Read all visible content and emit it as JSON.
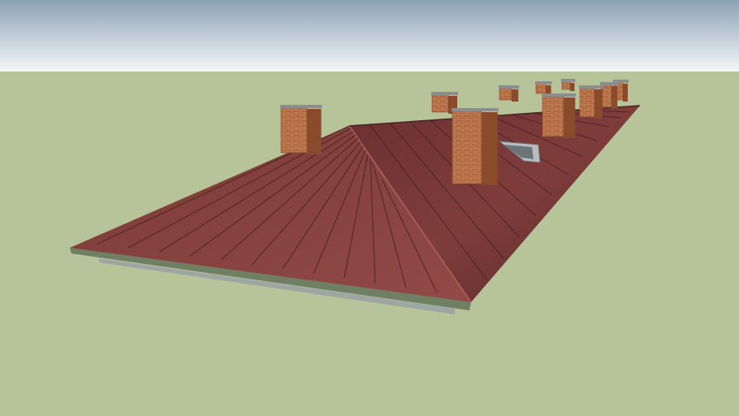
{
  "scene": {
    "subject": "roof",
    "colors": {
      "sky_top": "#8ea1b5",
      "sky_bottom": "#f4f6f8",
      "ground": "#b7c49a",
      "roof_main": "#7a3a38",
      "roof_dark": "#5e2c2c",
      "roof_hip": "#8a4442",
      "seam": "#4a2424",
      "eave": "#6f7f63",
      "eave_shadow": "#9aa3a3",
      "brick": "#b0683e",
      "brick_dark": "#8a4b2c",
      "brick_line": "#e3b187",
      "chimney_cap": "#8b8d8f"
    },
    "icons": {
      "sky": "sky-gradient",
      "ground": "ground-plane",
      "roof": "hip-roof-shape",
      "chimney": "brick-chimney-icon",
      "skylight": "roof-hatch-icon"
    }
  }
}
